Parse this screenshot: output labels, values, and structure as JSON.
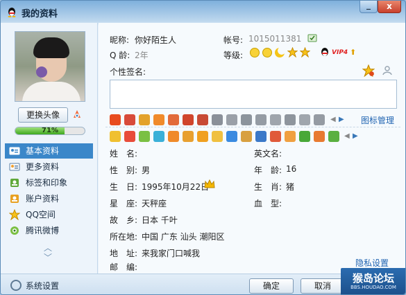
{
  "window": {
    "title": "我的资料",
    "close_glyph": "x",
    "minimize_glyph": "_"
  },
  "left_panel": {
    "change_avatar_label": "更换头像",
    "progress": {
      "percent": 71,
      "label": "71%"
    },
    "nav_items": [
      {
        "label": "基本资料",
        "icon": "id-card-icon",
        "active": true
      },
      {
        "label": "更多资料",
        "icon": "more-info-icon",
        "active": false
      },
      {
        "label": "标签和印象",
        "icon": "tag-icon",
        "active": false
      },
      {
        "label": "账户资料",
        "icon": "account-icon",
        "active": false
      },
      {
        "label": "QQ空间",
        "icon": "qzone-star-icon",
        "active": false
      },
      {
        "label": "腾讯微博",
        "icon": "weibo-icon",
        "active": false
      }
    ]
  },
  "profile": {
    "nickname_label": "昵称:",
    "nickname_value": "你好陌生人",
    "account_label": "帐号:",
    "account_value": "1015011381",
    "qage_label": "Q 龄:",
    "qage_value": "2年",
    "level_label": "等级:",
    "vip_label": "VIP4",
    "signature_label": "个性签名:",
    "signature_value": "",
    "icon_manage_label": "图标管理"
  },
  "details": {
    "name_label": "姓　名:",
    "name_value": "",
    "english_name_label": "英文名:",
    "english_name_value": "",
    "gender_label": "性　别:",
    "gender_value": "男",
    "age_label": "年　龄:",
    "age_value": "16",
    "birthday_label": "生　日:",
    "birthday_value": "1995年10月22日",
    "zodiac_label": "生　肖:",
    "zodiac_value": "猪",
    "constellation_label": "星　座:",
    "constellation_value": "天秤座",
    "blood_label": "血　型:",
    "blood_value": "",
    "hometown_label": "故　乡:",
    "hometown_value": "日本 千叶",
    "location_label": "所在地:",
    "location_value": "中国 广东 汕头 潮阳区",
    "address_label": "地　址:",
    "address_value": "来我家门口喊我",
    "postcode_label": "邮　编:",
    "postcode_value": ""
  },
  "footer": {
    "privacy_link": "隐私设置",
    "settings_label": "系统设置",
    "ok_label": "确定",
    "cancel_label": "取消",
    "watermark_text": "猴岛论坛",
    "watermark_sub": "BBS.HOUDAO.COM"
  },
  "colors": {
    "accent": "#3b87c9",
    "link": "#1f63b1",
    "progress": "#3fa91f"
  }
}
